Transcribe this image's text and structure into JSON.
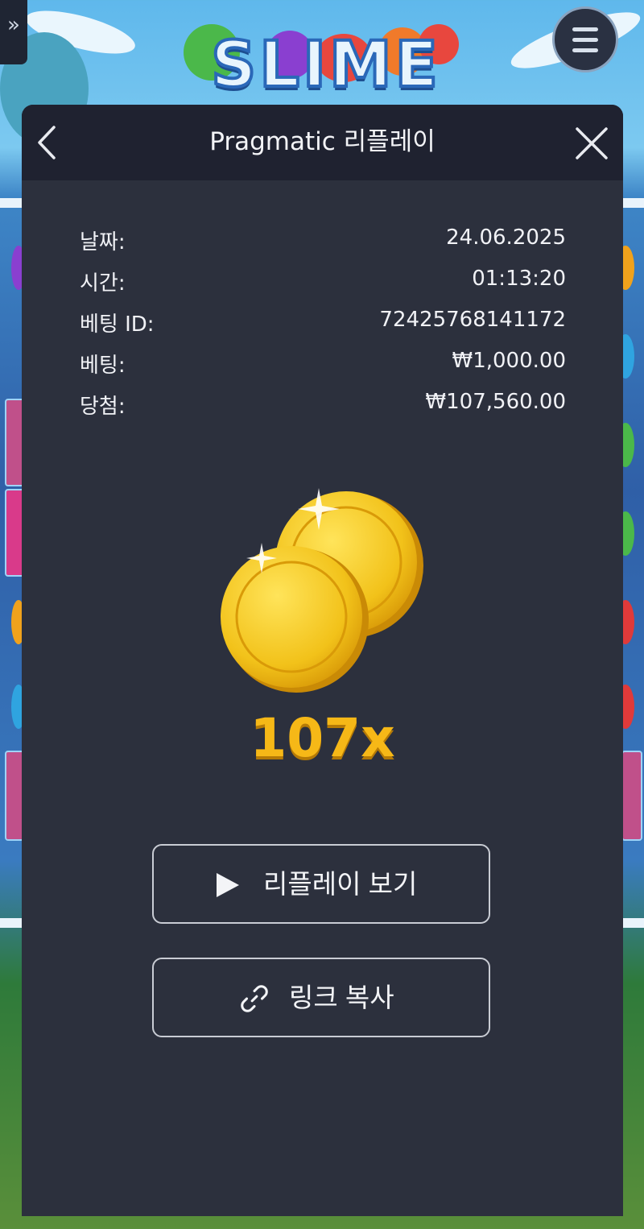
{
  "game": {
    "logo_text": "SLIME",
    "expand_glyph": "»",
    "menu_icon": "hamburger-menu-icon"
  },
  "panel": {
    "title": "Pragmatic 리플레이",
    "back_icon": "chevron-left-icon",
    "close_icon": "close-icon"
  },
  "details": [
    {
      "label": "날짜:",
      "value": "24.06.2025"
    },
    {
      "label": "시간:",
      "value": "01:13:20"
    },
    {
      "label": "베팅 ID:",
      "value": "72425768141172"
    },
    {
      "label": "베팅:",
      "value": "₩1,000.00"
    },
    {
      "label": "당첨:",
      "value": "₩107,560.00"
    }
  ],
  "multiplier": "107x",
  "buttons": {
    "replay_label": "리플레이 보기",
    "copy_label": "링크 복사"
  },
  "colors": {
    "panel_bg": "#2c303d",
    "header_bg": "#1f2230",
    "multiplier": "#f6b817",
    "coin": "#f2c21a"
  }
}
